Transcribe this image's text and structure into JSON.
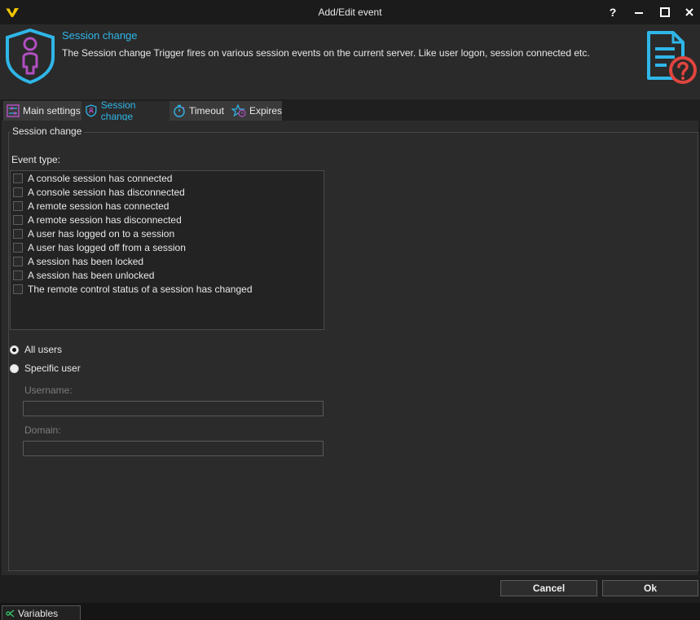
{
  "window": {
    "title": "Add/Edit event",
    "help": "?",
    "minimize": "─",
    "maximize": "□",
    "close": "✕"
  },
  "header": {
    "title": "Session change",
    "description": "The Session change Trigger fires on various session events on the current server. Like user logon, session connected etc."
  },
  "tabs": [
    {
      "label": "Main settings",
      "icon": "sliders-icon",
      "active": false
    },
    {
      "label": "Session change",
      "icon": "shield-user-icon",
      "active": true
    },
    {
      "label": "Timeout",
      "icon": "stopwatch-icon",
      "active": false
    },
    {
      "label": "Expires",
      "icon": "star-clock-icon",
      "active": false
    }
  ],
  "group": {
    "legend": "Session change",
    "event_type_label": "Event type:"
  },
  "events": [
    {
      "label": "A console session has connected",
      "checked": false
    },
    {
      "label": "A console session has disconnected",
      "checked": false
    },
    {
      "label": "A remote session has connected",
      "checked": false
    },
    {
      "label": "A remote session has disconnected",
      "checked": false
    },
    {
      "label": "A user has logged on to a session",
      "checked": false
    },
    {
      "label": "A user has logged off from a session",
      "checked": false
    },
    {
      "label": "A session has been locked",
      "checked": false
    },
    {
      "label": "A session has been unlocked",
      "checked": false
    },
    {
      "label": "The remote control status of a session has changed",
      "checked": false
    }
  ],
  "user_scope": {
    "all_users": "All users",
    "specific_user": "Specific user",
    "selected": "all_users",
    "username_label": "Username:",
    "username_value": "",
    "domain_label": "Domain:",
    "domain_value": ""
  },
  "footer": {
    "cancel": "Cancel",
    "ok": "Ok"
  },
  "statusbar": {
    "variables": "Variables"
  },
  "colors": {
    "accent": "#2fb6e8",
    "brand_purple": "#b04fc0",
    "help_red": "#e0453f"
  }
}
